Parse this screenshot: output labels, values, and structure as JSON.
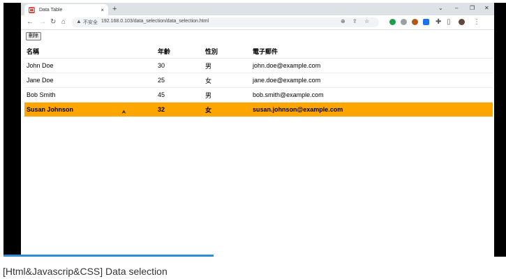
{
  "browser": {
    "tab_title": "Data Table",
    "new_tab": "+",
    "tab_close": "×",
    "insecure_label": "不安全",
    "url": "192.168.0.103/data_selection/data_selection.html",
    "window_buttons": {
      "chevron": "⌄",
      "minimize": "–",
      "restore": "❐",
      "close": "✕"
    }
  },
  "page": {
    "delete_button": "刪除",
    "table": {
      "headers": [
        "名稱",
        "年齡",
        "性別",
        "電子郵件"
      ],
      "rows": [
        {
          "name": "John Doe",
          "age": "30",
          "gender": "男",
          "email": "john.doe@example.com",
          "selected": false
        },
        {
          "name": "Jane Doe",
          "age": "25",
          "gender": "女",
          "email": "jane.doe@example.com",
          "selected": false
        },
        {
          "name": "Bob Smith",
          "age": "45",
          "gender": "男",
          "email": "bob.smith@example.com",
          "selected": false
        },
        {
          "name": "Susan Johnson",
          "age": "32",
          "gender": "女",
          "email": "susan.johnson@example.com",
          "selected": true
        }
      ]
    }
  },
  "colors": {
    "selected_row": "#ffa500",
    "progress": "#2b8fd6"
  },
  "caption": "[Html&Javascrip&CSS] Data selection"
}
